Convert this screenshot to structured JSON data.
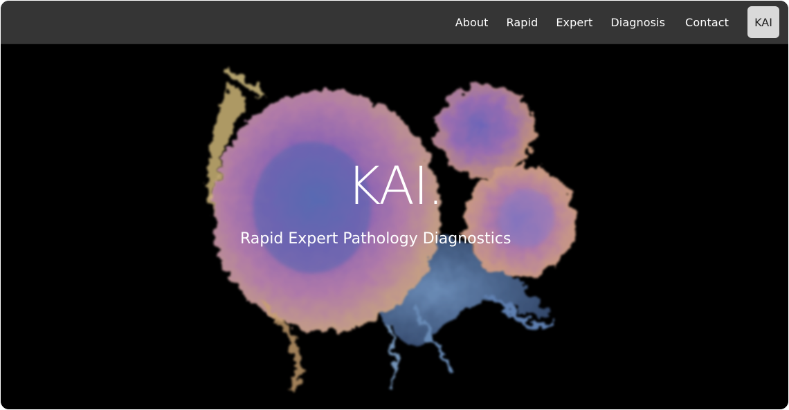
{
  "nav": {
    "links": [
      "About",
      "Rapid",
      "Expert",
      "Diagnosis",
      "Contact"
    ],
    "brand_button": "KAI"
  },
  "hero": {
    "title": "KAI.",
    "subtitle": "Rapid Expert Pathology Diagnostics",
    "image_name": "cancer-cell-micrograph"
  },
  "colors": {
    "navbar_bg": "#353535",
    "hero_bg": "#000000",
    "brand_button_bg": "#d9d9d9",
    "text": "#ffffff"
  }
}
